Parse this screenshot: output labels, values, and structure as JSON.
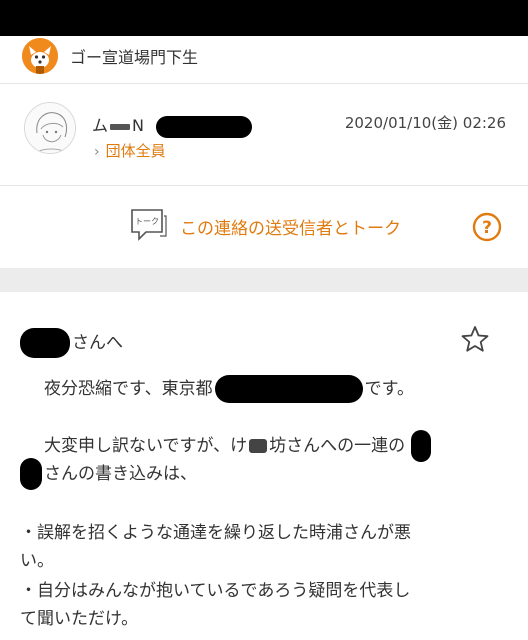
{
  "group": {
    "name": "ゴー宣道場門下生",
    "avatar_icon": "fox-avatar-icon"
  },
  "sender": {
    "name_prefix": "ム",
    "name_suffix": "N",
    "date": "2020/01/10(金) 02:26",
    "recipient": "団体全員",
    "avatar_icon": "person-sketch-avatar"
  },
  "talk": {
    "label": "この連絡の送受信者とトーク",
    "icon_text": "トーク"
  },
  "message": {
    "salutation_suffix": "さんへ",
    "line1_a": "夜分恐縮です、東京都",
    "line1_b": "です。",
    "line2_a": "大変申し訳ないですが、け",
    "line2_b": "坊さんへの一連の",
    "line3": "さんの書き込みは、",
    "line4": "・誤解を招くような通達を繰り返した時浦さんが悪",
    "line5": "い。",
    "line6": "・自分はみんなが抱いているであろう疑問を代表し",
    "line7": "て聞いただけ。"
  },
  "colors": {
    "accent": "#e07b10",
    "text": "#333333",
    "separator": "#ececec"
  }
}
